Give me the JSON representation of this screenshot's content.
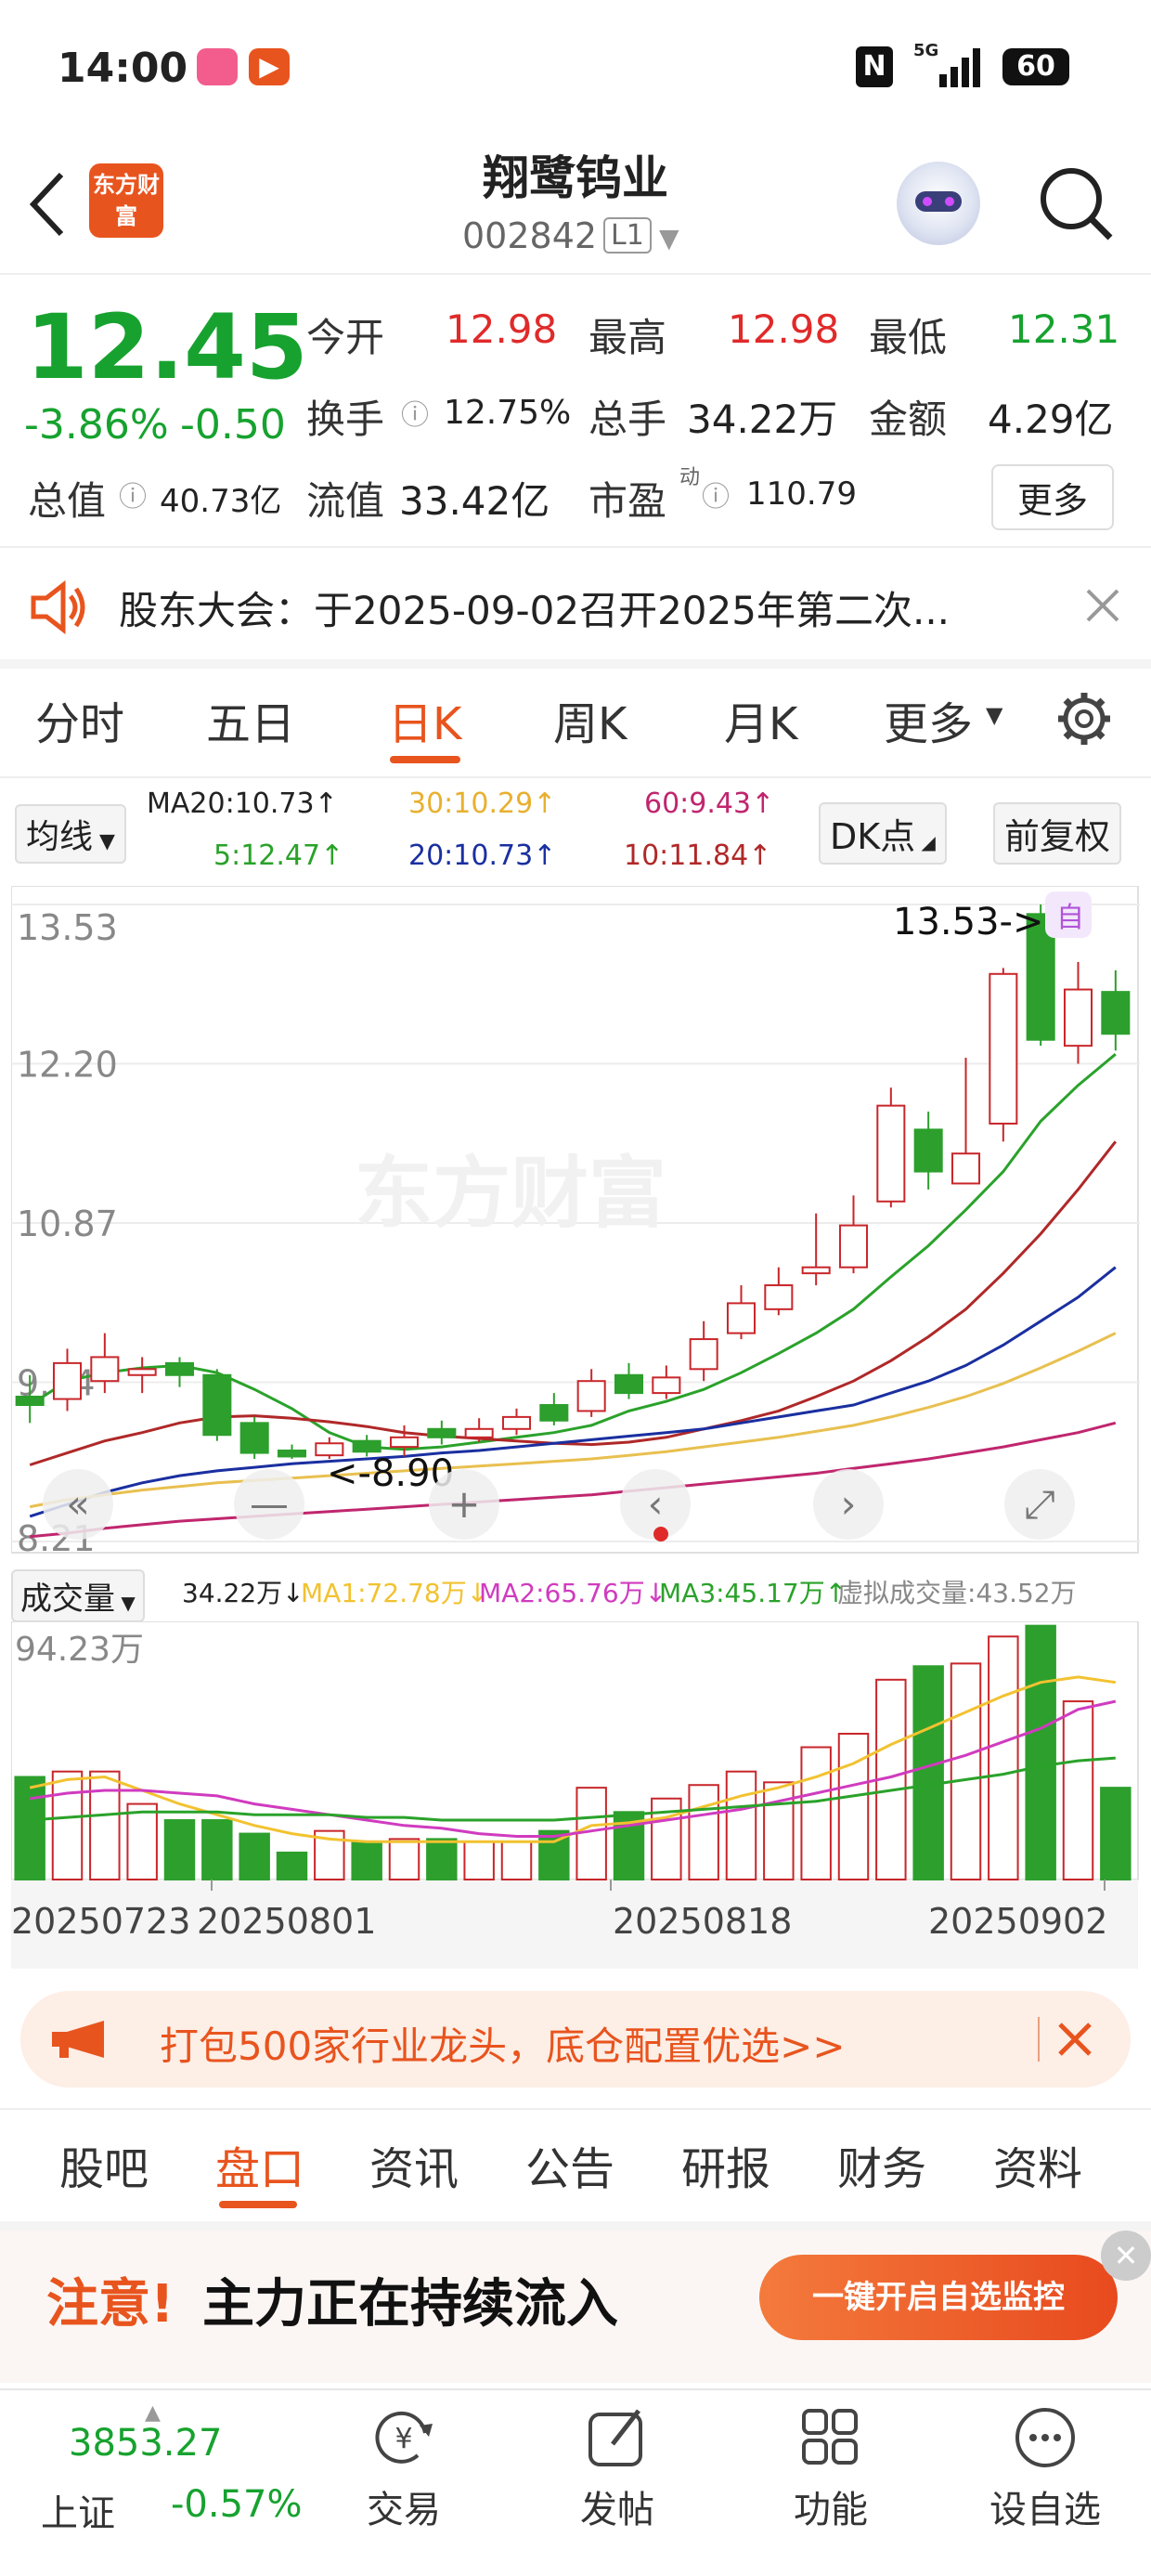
{
  "status_bar": {
    "time": "14:00",
    "network": "5G",
    "battery": "60"
  },
  "header": {
    "stock_name": "翔鹭钨业",
    "stock_code": "002842",
    "level": "L1",
    "logo_text": "东方财富"
  },
  "quote": {
    "price": "12.45",
    "change_pct": "-3.86%",
    "change": "-0.50",
    "open_label": "今开",
    "open": "12.98",
    "high_label": "最高",
    "high": "12.98",
    "low_label": "最低",
    "low": "12.31",
    "turnover_label": "换手",
    "turnover": "12.75%",
    "volume_label": "总手",
    "volume": "34.22万",
    "amount_label": "金额",
    "amount": "4.29亿",
    "mktcap_label": "总值",
    "mktcap": "40.73亿",
    "float_label": "流值",
    "float": "33.42亿",
    "pe_label": "市盈",
    "pe_sup": "动",
    "pe": "110.79",
    "more_button": "更多"
  },
  "notice": {
    "text": "股东大会：于2025-09-02召开2025年第二次..."
  },
  "chart_tabs": [
    "分时",
    "五日",
    "日K",
    "周K",
    "月K",
    "更多"
  ],
  "active_tab": "日K",
  "indicator": {
    "selector": "均线",
    "ma20": "MA20:10.73↑",
    "ma30": "30:10.29↑",
    "ma60": "60:9.43↑",
    "ma5": "5:12.47↑",
    "ma20b": "20:10.73↑",
    "ma10": "10:11.84↑",
    "dk_button": "DK点",
    "fq_button": "前复权"
  },
  "chart_data": [
    {
      "type": "candlestick",
      "y_axis_ticks": [
        "13.53",
        "12.20",
        "10.87",
        "9.54",
        "8.21"
      ],
      "ylim": [
        8.21,
        13.53
      ],
      "high_marker": "13.53->",
      "low_marker": "<-8.90",
      "self_badge": "自",
      "watermark": "东方财富",
      "candles": [
        {
          "o": 9.42,
          "c": 9.35,
          "h": 9.6,
          "l": 9.2
        },
        {
          "o": 9.4,
          "c": 9.7,
          "h": 9.82,
          "l": 9.3
        },
        {
          "o": 9.55,
          "c": 9.75,
          "h": 9.95,
          "l": 9.45
        },
        {
          "o": 9.6,
          "c": 9.65,
          "h": 9.75,
          "l": 9.45
        },
        {
          "o": 9.7,
          "c": 9.6,
          "h": 9.75,
          "l": 9.5
        },
        {
          "o": 9.6,
          "c": 9.1,
          "h": 9.65,
          "l": 9.05
        },
        {
          "o": 9.2,
          "c": 8.95,
          "h": 9.25,
          "l": 8.9
        },
        {
          "o": 8.97,
          "c": 8.92,
          "h": 9.02,
          "l": 8.9
        },
        {
          "o": 8.93,
          "c": 9.03,
          "h": 9.08,
          "l": 8.9
        },
        {
          "o": 9.05,
          "c": 8.96,
          "h": 9.1,
          "l": 8.92
        },
        {
          "o": 9.0,
          "c": 9.08,
          "h": 9.18,
          "l": 8.92
        },
        {
          "o": 9.15,
          "c": 9.08,
          "h": 9.22,
          "l": 9.02
        },
        {
          "o": 9.08,
          "c": 9.15,
          "h": 9.24,
          "l": 9.04
        },
        {
          "o": 9.15,
          "c": 9.25,
          "h": 9.32,
          "l": 9.1
        },
        {
          "o": 9.35,
          "c": 9.22,
          "h": 9.45,
          "l": 9.18
        },
        {
          "o": 9.3,
          "c": 9.55,
          "h": 9.65,
          "l": 9.25
        },
        {
          "o": 9.6,
          "c": 9.45,
          "h": 9.7,
          "l": 9.4
        },
        {
          "o": 9.45,
          "c": 9.58,
          "h": 9.68,
          "l": 9.4
        },
        {
          "o": 9.65,
          "c": 9.9,
          "h": 10.05,
          "l": 9.55
        },
        {
          "o": 9.95,
          "c": 10.2,
          "h": 10.35,
          "l": 9.9
        },
        {
          "o": 10.15,
          "c": 10.35,
          "h": 10.5,
          "l": 10.1
        },
        {
          "o": 10.45,
          "c": 10.5,
          "h": 10.95,
          "l": 10.35
        },
        {
          "o": 10.5,
          "c": 10.85,
          "h": 11.1,
          "l": 10.45
        },
        {
          "o": 11.05,
          "c": 11.85,
          "h": 12.0,
          "l": 11.0
        },
        {
          "o": 11.65,
          "c": 11.3,
          "h": 11.8,
          "l": 11.15
        },
        {
          "o": 11.2,
          "c": 11.45,
          "h": 12.25,
          "l": 11.2
        },
        {
          "o": 11.7,
          "c": 12.95,
          "h": 13.0,
          "l": 11.55
        },
        {
          "o": 13.45,
          "c": 12.4,
          "h": 13.53,
          "l": 12.35
        },
        {
          "o": 12.35,
          "c": 12.82,
          "h": 13.05,
          "l": 12.2
        },
        {
          "o": 12.8,
          "c": 12.45,
          "h": 12.98,
          "l": 12.31
        }
      ],
      "ma_lines": [
        {
          "name": "MA5",
          "color": "#2aa22a",
          "values": [
            9.35,
            9.55,
            9.62,
            9.66,
            9.68,
            9.62,
            9.48,
            9.32,
            9.12,
            9.0,
            8.98,
            9.0,
            9.04,
            9.08,
            9.12,
            9.18,
            9.3,
            9.38,
            9.48,
            9.62,
            9.78,
            9.95,
            10.15,
            10.42,
            10.68,
            10.98,
            11.3,
            11.72,
            12.02,
            12.28
          ]
        },
        {
          "name": "MA10",
          "color": "#b02828",
          "values": [
            8.85,
            8.95,
            9.05,
            9.12,
            9.2,
            9.25,
            9.26,
            9.24,
            9.21,
            9.17,
            9.12,
            9.09,
            9.07,
            9.05,
            9.03,
            9.02,
            9.04,
            9.08,
            9.15,
            9.22,
            9.3,
            9.42,
            9.55,
            9.72,
            9.92,
            10.15,
            10.45,
            10.78,
            11.15,
            11.55
          ]
        },
        {
          "name": "MA20",
          "color": "#1a2fa0",
          "values": [
            8.42,
            8.52,
            8.62,
            8.7,
            8.76,
            8.8,
            8.83,
            8.86,
            8.88,
            8.9,
            8.92,
            8.95,
            8.97,
            9.0,
            9.03,
            9.06,
            9.09,
            9.12,
            9.15,
            9.2,
            9.25,
            9.3,
            9.35,
            9.45,
            9.55,
            9.68,
            9.85,
            10.05,
            10.25,
            10.5
          ]
        },
        {
          "name": "MA30",
          "color": "#e8c050",
          "values": [
            8.5,
            8.56,
            8.6,
            8.64,
            8.67,
            8.7,
            8.72,
            8.74,
            8.76,
            8.78,
            8.8,
            8.82,
            8.84,
            8.86,
            8.88,
            8.9,
            8.93,
            8.96,
            9.0,
            9.04,
            9.08,
            9.13,
            9.18,
            9.25,
            9.33,
            9.42,
            9.53,
            9.66,
            9.8,
            9.95
          ]
        },
        {
          "name": "MA60",
          "color": "#c0266e",
          "values": [
            8.25,
            8.28,
            8.32,
            8.35,
            8.38,
            8.4,
            8.42,
            8.44,
            8.46,
            8.48,
            8.5,
            8.52,
            8.54,
            8.56,
            8.58,
            8.6,
            8.63,
            8.66,
            8.69,
            8.72,
            8.75,
            8.78,
            8.82,
            8.86,
            8.9,
            8.95,
            9.0,
            9.06,
            9.12,
            9.2
          ]
        }
      ]
    },
    {
      "type": "bar",
      "title": "成交量",
      "y_axis_ticks": [
        "94.23万"
      ],
      "ylim": [
        0,
        94.23
      ],
      "x_tick_labels": [
        "20250723",
        "20250801",
        "20250818",
        "20250902"
      ],
      "values": [
        38,
        40,
        40,
        28,
        22,
        22,
        17,
        10,
        18,
        14,
        15,
        15,
        14,
        14,
        18,
        34,
        25,
        30,
        35,
        40,
        36,
        49,
        54,
        74,
        79,
        80,
        90,
        94,
        66,
        34
      ],
      "volume_text": "34.22万↓",
      "ma1": "MA1:72.78万↓",
      "ma2": "MA2:65.76万↓",
      "ma3": "MA3:45.17万↑",
      "virtual": "虚拟成交量:43.52万",
      "ma_lines": [
        {
          "name": "MA1",
          "color": "#f2c230",
          "values": [
            34,
            37,
            38,
            33,
            28,
            24,
            20,
            17,
            15,
            14,
            14,
            14,
            14,
            14,
            14,
            20,
            21,
            23,
            27,
            31,
            34,
            38,
            43,
            50,
            56,
            62,
            68,
            73,
            75,
            73
          ]
        },
        {
          "name": "MA2",
          "color": "#d03bbf",
          "values": [
            30,
            32,
            33,
            33,
            32,
            31,
            28,
            26,
            24,
            22,
            20,
            19,
            17,
            16,
            16,
            18,
            20,
            22,
            24,
            26,
            29,
            32,
            35,
            38,
            42,
            46,
            51,
            56,
            63,
            66
          ]
        },
        {
          "name": "MA3",
          "color": "#2aa22a",
          "values": [
            22,
            23,
            24,
            25,
            25,
            25,
            24,
            24,
            24,
            23,
            23,
            22,
            22,
            22,
            22,
            23,
            24,
            25,
            26,
            27,
            28,
            29,
            31,
            33,
            35,
            37,
            39,
            42,
            44,
            45
          ]
        }
      ]
    }
  ],
  "promo_banner": {
    "text": "打包500家行业龙头，底仓配置优选>>"
  },
  "sub_tabs": [
    "股吧",
    "盘口",
    "资讯",
    "公告",
    "研报",
    "财务",
    "资料"
  ],
  "active_sub_tab": "盘口",
  "ad": {
    "attention": "注意!",
    "text": "主力正在持续流入",
    "button": "一键开启自选监控"
  },
  "bottom_bar": {
    "index_value": "3853.27",
    "index_name": "上证",
    "index_change": "-0.57%",
    "items": [
      "交易",
      "发帖",
      "功能",
      "设自选"
    ]
  }
}
